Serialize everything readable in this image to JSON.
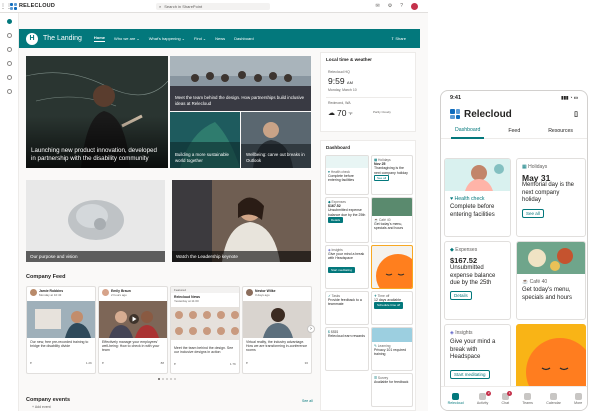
{
  "topbar": {
    "brand": "RELECLOUD",
    "search_placeholder": "Search in SharePoint",
    "icons": [
      "chat-icon",
      "settings-icon",
      "help-icon",
      "avatar"
    ]
  },
  "hub": {
    "title": "The Landing",
    "logo_letter": "H",
    "nav": [
      "Home",
      "Who we are",
      "What's happening",
      "Find",
      "News",
      "Dashboard"
    ],
    "share": "Share",
    "color": "#03787c"
  },
  "hero": {
    "main_caption": "Launching new product innovation, developed in partnership with the disability community",
    "team_caption": "Meet the team behind the design. How partnerships build inclusive ideas at Relecloud",
    "sustain_caption": "Building a more sustainable world together",
    "wellbeing_caption": "Wellbeing: carve out breaks in Outlook",
    "purpose_caption": "Our purpose and vision",
    "keynote_caption": "Watch the Leadership keynote"
  },
  "feed": {
    "title": "Company Feed",
    "cards": [
      {
        "name": "Jamie Robbins",
        "time": "Monday at 10:43",
        "text": "Our new, free pre-recorded training to bridge the disability divide",
        "meta": "1.2K"
      },
      {
        "name": "Emily Braun",
        "time": "2 hours ago",
        "text": "Effectively manage your employees' well-being: How to check in with your team",
        "meta": "88"
      },
      {
        "name": "Relecloud News",
        "time": "Yesterday at 11:00",
        "text": "Meet the team behind the design. See our inclusive designs in action",
        "meta": "1.7K"
      },
      {
        "name": "Nestor Wilke",
        "time": "3 days ago",
        "text": "Virtual reality, the industry advantage. How we are transforming in-conference rooms",
        "meta": "36"
      }
    ],
    "featured_badge": "Featured"
  },
  "events": {
    "title": "Company events",
    "see_all": "See all",
    "add": "Add event"
  },
  "local": {
    "title": "Local time & weather",
    "city1": "Relecloud HQ",
    "time1": "9:59",
    "ampm1": "AM",
    "date1": "Monday, March 10",
    "city2": "Redmond, WA",
    "temp": "70",
    "unit": "°F",
    "cond": "Partly Cloudy"
  },
  "dashboard": {
    "title": "Dashboard",
    "health_label": "Health check",
    "health_text": "Complete before entering facilities",
    "holidays_label": "Holidays",
    "holidays_date": "Nov 25",
    "holidays_text": "Thanksgiving is the next company holiday",
    "see_all": "See all",
    "expenses_label": "Expenses",
    "expenses_amount": "$167.52",
    "expenses_text": "Unsubmitted expense balance due by the 25th",
    "details": "Details",
    "cafe_label": "Café 40",
    "cafe_text": "Get today's menu, specials and hours",
    "insights_label": "Insights",
    "insights_text": "Give your mind a break with Headspace",
    "start": "Start meditating",
    "timeoff_label": "Time off",
    "timeoff_text": "12 days available",
    "tasks_label": "Tasks",
    "tasks_text": "Provide feedback to a teammate",
    "schedule": "Schedule time off",
    "pay_amount": "$$$$",
    "pay_text": "Relecloud earn rewards",
    "learning_label": "Learning",
    "learning_text": "Privacy 101 required training",
    "survey_label": "Survey",
    "survey_text": "Available for feedback"
  },
  "phone": {
    "time": "9:41",
    "title": "Relecloud",
    "tabs": [
      "Dashboard",
      "Feed",
      "Resources"
    ],
    "health_label": "Health check",
    "health_text": "Complete before entering facilities",
    "holidays_label": "Holidays",
    "holidays_date": "May 31",
    "holidays_text": "Memorial day is the next company holiday",
    "see_all": "See all",
    "expenses_label": "Expenses",
    "expenses_amount": "$167.52",
    "expenses_text": "Unsubmitted expense balance due by the 25th",
    "details": "Details",
    "cafe_label": "Café 40",
    "cafe_text": "Get today's menu, specials and hours",
    "insights_label": "Insights",
    "insights_text": "Give your mind a break with Headspace",
    "start": "Start meditating",
    "bottom_nav": [
      "Relecloud",
      "Activity",
      "Chat",
      "Teams",
      "Calendar",
      "More"
    ],
    "activity_badge": "2",
    "chat_badge": "1"
  }
}
